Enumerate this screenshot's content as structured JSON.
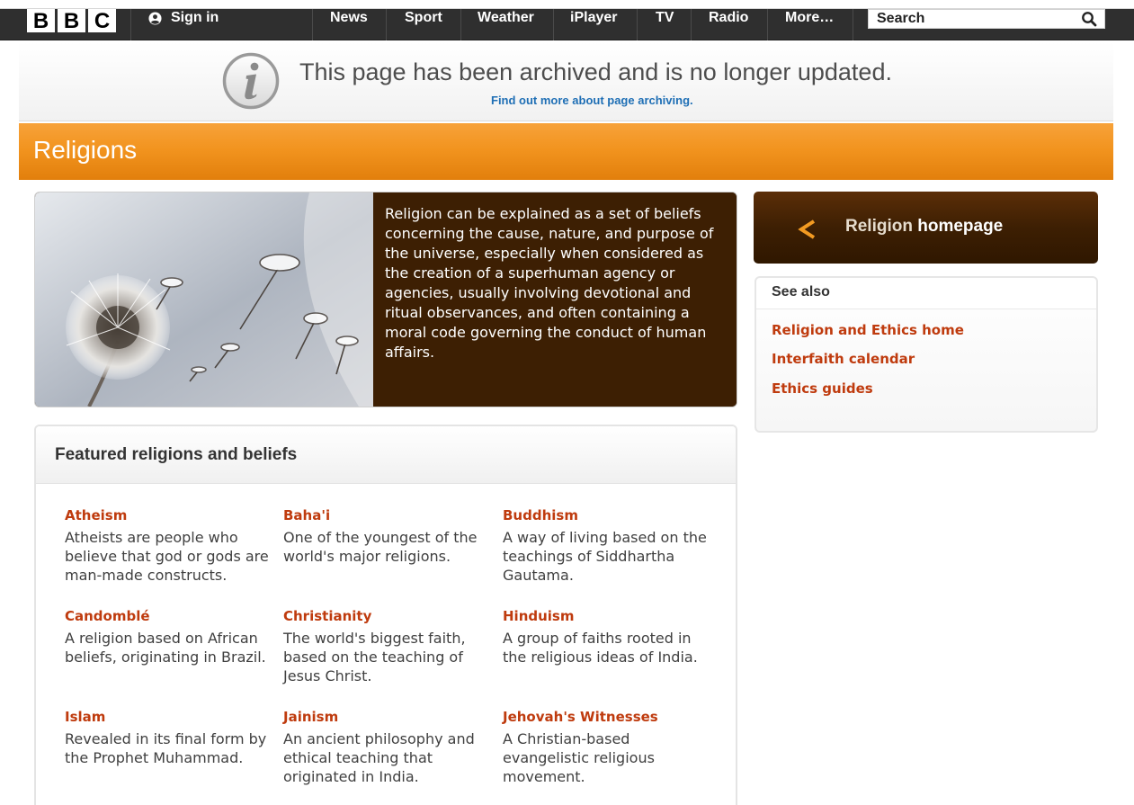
{
  "header": {
    "logo_letters": [
      "B",
      "B",
      "C"
    ],
    "sign_in": "Sign in",
    "nav": [
      "News",
      "Sport",
      "Weather",
      "iPlayer",
      "TV",
      "Radio",
      "More…"
    ],
    "search_placeholder": "Search"
  },
  "archive": {
    "message": "This page has been archived and is no longer updated.",
    "link": "Find out more about page archiving."
  },
  "banner": {
    "title": "Religions"
  },
  "hero": {
    "text": "Religion can be explained as a set of beliefs concerning the cause, nature, and purpose of the universe, especially when considered as the creation of a superhuman agency or agencies, usually involving devotional and ritual observances, and often containing a moral code governing the conduct of human affairs."
  },
  "featured": {
    "title": "Featured religions and beliefs",
    "items": [
      {
        "name": "Atheism",
        "desc": "Atheists are people who believe that god or gods are man-made constructs."
      },
      {
        "name": "Baha'i",
        "desc": "One of the youngest of the world's major religions."
      },
      {
        "name": "Buddhism",
        "desc": "A way of living based on the teachings of Siddhartha Gautama."
      },
      {
        "name": "Candomblé",
        "desc": "A religion based on African beliefs, originating in Brazil."
      },
      {
        "name": "Christianity",
        "desc": "The world's biggest faith, based on the teaching of Jesus Christ."
      },
      {
        "name": "Hinduism",
        "desc": "A group of faiths rooted in the religious ideas of India."
      },
      {
        "name": "Islam",
        "desc": "Revealed in its final form by the Prophet Muhammad."
      },
      {
        "name": "Jainism",
        "desc": "An ancient philosophy and ethical teaching that originated in India."
      },
      {
        "name": "Jehovah's Witnesses",
        "desc": "A Christian-based evangelistic religious movement."
      }
    ]
  },
  "sidebar": {
    "home_label_part1": "Religion",
    "home_label_part2": "homepage",
    "see_also_title": "See also",
    "see_also_links": [
      "Religion and Ethics home",
      "Interfaith calendar",
      "Ethics guides"
    ]
  },
  "colors": {
    "orange_banner": "#f2941f",
    "dark_brown": "#3d1f03",
    "link_red": "#bf3b0e",
    "archive_link_blue": "#1f6fb5",
    "bbc_bar": "#2f2f2f"
  }
}
